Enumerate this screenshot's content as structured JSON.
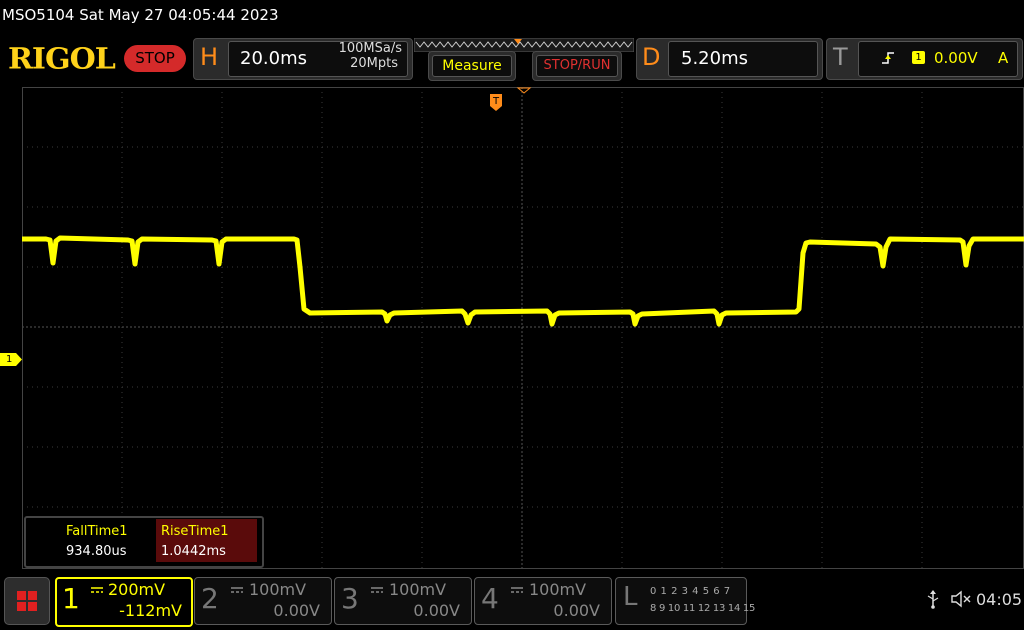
{
  "status_line": "MSO5104  Sat May 27 04:05:44 2023",
  "brand": "RIGOL",
  "run_state": "STOP",
  "horizontal": {
    "letter": "H",
    "timebase": "20.0ms",
    "sample_rate": "100MSa/s",
    "memory_depth": "20Mpts"
  },
  "buttons": {
    "measure": "Measure",
    "stop_run": "STOP/RUN"
  },
  "delay": {
    "letter": "D",
    "value": "5.20ms"
  },
  "trigger": {
    "letter": "T",
    "source": "1",
    "level": "0.00V",
    "mode": "A",
    "marker": "T"
  },
  "channel_marker": "1",
  "measurements": [
    {
      "label": "FallTime1",
      "value": "934.80us"
    },
    {
      "label": "RiseTime1",
      "value": "1.0442ms"
    }
  ],
  "channels": [
    {
      "number": "1",
      "scale": "200mV",
      "offset": "-112mV"
    },
    {
      "number": "2",
      "scale": "100mV",
      "offset": "0.00V"
    },
    {
      "number": "3",
      "scale": "100mV",
      "offset": "0.00V"
    },
    {
      "number": "4",
      "scale": "100mV",
      "offset": "0.00V"
    }
  ],
  "logic_analyzer": {
    "letter": "L",
    "row1": "0 1 2 3  4 5 6 7",
    "row2": "8 9 10 11 12 13 14 15"
  },
  "clock": "04:05",
  "colors": {
    "ch1": "#ffff00",
    "accent_orange": "#ff8c1a",
    "stop_red": "#d42a2a"
  },
  "icons": {
    "usb": "usb-icon",
    "speaker": "speaker-muted-icon",
    "menu": "grid-menu-icon"
  }
}
